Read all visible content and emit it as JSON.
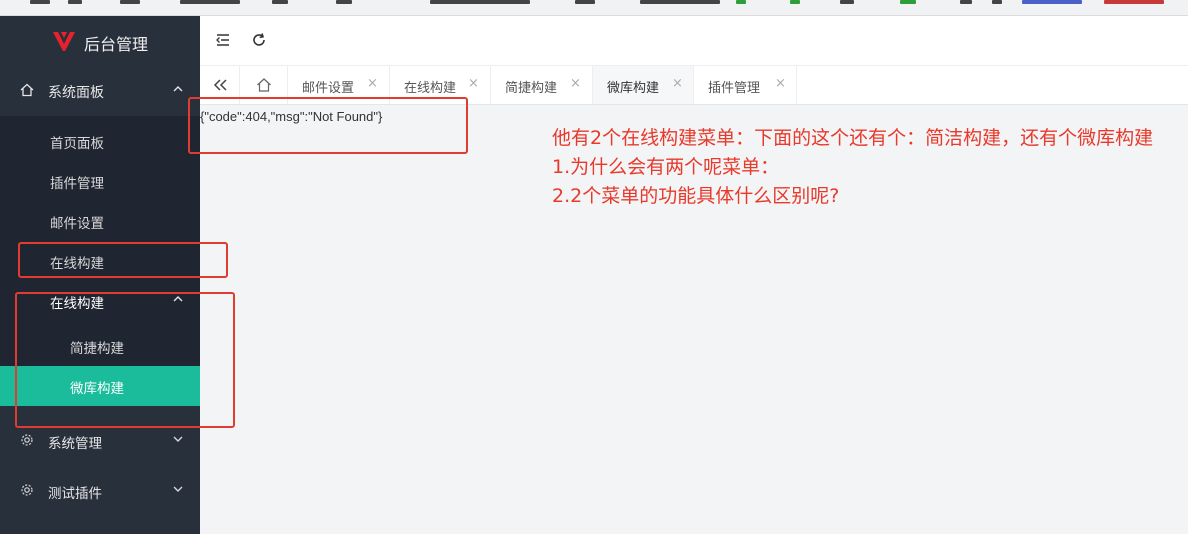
{
  "app": {
    "title": "后台管理",
    "brand_color": "#e8212d"
  },
  "sidebar": {
    "groups": [
      {
        "label": "系统面板",
        "icon": "home-icon",
        "expanded": true
      },
      {
        "label": "系统管理",
        "icon": "gear-icon",
        "expanded": false
      },
      {
        "label": "测试插件",
        "icon": "gear-icon",
        "expanded": false
      }
    ],
    "items": [
      {
        "label": "首页面板"
      },
      {
        "label": "插件管理"
      },
      {
        "label": "邮件设置"
      },
      {
        "label": "在线构建"
      },
      {
        "label": "在线构建",
        "expanded": true
      }
    ],
    "children": [
      {
        "label": "简捷构建"
      },
      {
        "label": "微库构建",
        "active": true
      }
    ],
    "active_color": "#1abc9c"
  },
  "tabs": [
    {
      "label": "邮件设置"
    },
    {
      "label": "在线构建"
    },
    {
      "label": "简捷构建"
    },
    {
      "label": "微库构建",
      "selected": true
    },
    {
      "label": "插件管理"
    }
  ],
  "content": {
    "response_text": "{\"code\":404,\"msg\":\"Not Found\"}"
  },
  "annotation": {
    "line1": "他有2个在线构建菜单：下面的这个还有个：简洁构建，还有个微库构建",
    "line2": "1.为什么会有两个呢菜单：",
    "line3": "2.2个菜单的功能具体什么区别呢?",
    "color": "#e8392b"
  }
}
